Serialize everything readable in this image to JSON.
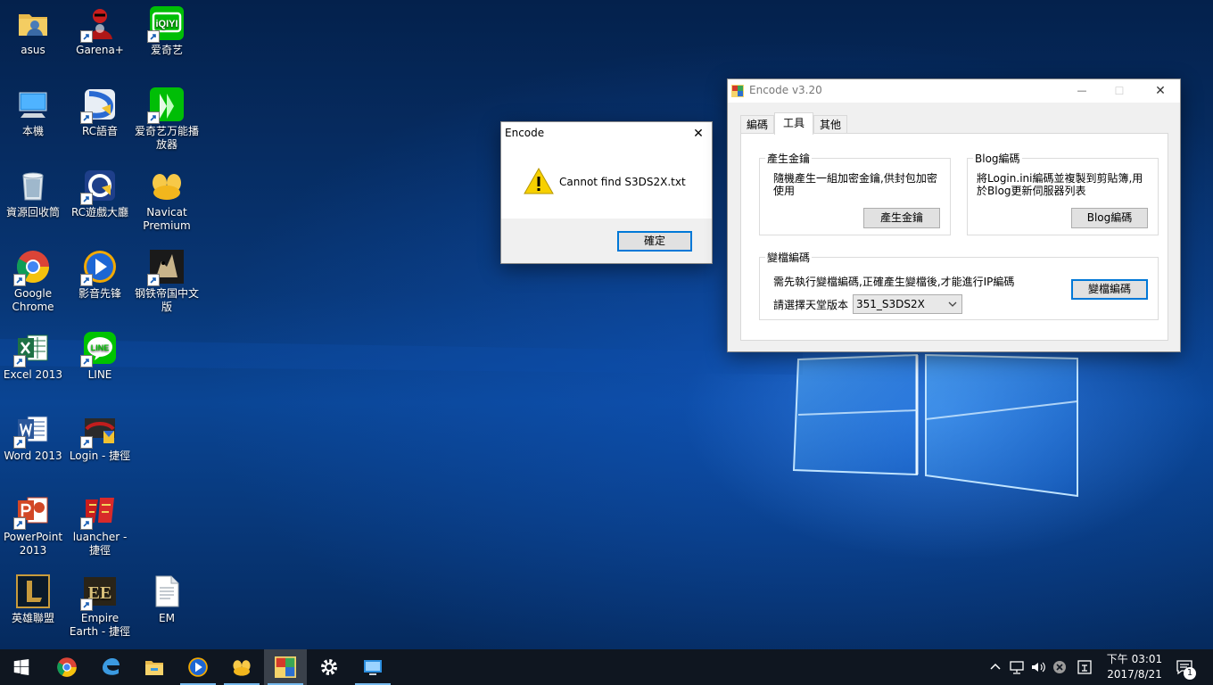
{
  "desktop": {
    "icons": [
      {
        "label": "asus",
        "icon": "user-folder-icon"
      },
      {
        "label": "Garena+",
        "icon": "garena-icon"
      },
      {
        "label": "爱奇艺",
        "icon": "iqiyi-icon"
      },
      {
        "label": "本機",
        "icon": "computer-icon"
      },
      {
        "label": "RC語音",
        "icon": "rc-voice-icon"
      },
      {
        "label": "爱奇艺万能播放器",
        "icon": "iqiyi-player-icon"
      },
      {
        "label": "資源回收筒",
        "icon": "recycle-bin-icon"
      },
      {
        "label": "RC遊戲大廳",
        "icon": "rc-lobby-icon"
      },
      {
        "label": "Navicat Premium",
        "icon": "navicat-icon"
      },
      {
        "label": "Google Chrome",
        "icon": "chrome-icon"
      },
      {
        "label": "影音先锋",
        "icon": "media-player-icon"
      },
      {
        "label": "钢铁帝国中文版",
        "icon": "steel-empire-icon"
      },
      {
        "label": "Excel 2013",
        "icon": "excel-icon"
      },
      {
        "label": "LINE",
        "icon": "line-icon"
      },
      {
        "label": "Word 2013",
        "icon": "word-icon"
      },
      {
        "label": "Login - 捷徑",
        "icon": "login-icon"
      },
      {
        "label": "PowerPoint 2013",
        "icon": "powerpoint-icon"
      },
      {
        "label": "luancher - 捷徑",
        "icon": "launcher-icon"
      },
      {
        "label": "英雄聯盟",
        "icon": "league-icon"
      },
      {
        "label": "Empire Earth - 捷徑",
        "icon": "empire-earth-icon"
      },
      {
        "label": "EM",
        "icon": "text-file-icon"
      }
    ]
  },
  "message_box": {
    "title": "Encode",
    "message": "Cannot find S3DS2X.txt",
    "ok_label": "確定",
    "close_glyph": "✕"
  },
  "encode_window": {
    "title": "Encode v3.20",
    "minimize_glyph": "—",
    "maximize_glyph": "☐",
    "close_glyph": "✕",
    "tabs": [
      "編碼",
      "工具",
      "其他"
    ],
    "active_tab": "工具",
    "key_group": {
      "legend": "產生金鑰",
      "text": "隨機產生一組加密金鑰,供封包加密使用",
      "button": "產生金鑰"
    },
    "blog_group": {
      "legend": "Blog編碼",
      "text": "將Login.ini編碼並複製到剪貼簿,用於Blog更新伺服器列表",
      "button": "Blog編碼"
    },
    "file_group": {
      "legend": "變檔編碼",
      "text": "需先執行變檔編碼,正確產生變檔後,才能進行IP編碼",
      "version_label": "請選擇天堂版本",
      "version_value": "351_S3DS2X",
      "button": "變檔編碼"
    }
  },
  "taskbar": {
    "items": [
      "start-button",
      "chrome-icon",
      "edge-icon",
      "file-explorer-icon",
      "media-player-icon",
      "navicat-icon",
      "encode-app-icon",
      "settings-icon",
      "remote-desktop-icon"
    ],
    "clock_time": "下午 03:01",
    "clock_date": "2017/8/21",
    "notification_count": "1"
  },
  "colors": {
    "accent": "#0078d7",
    "taskbar": "#0f1620",
    "warning": "#f7d000"
  }
}
